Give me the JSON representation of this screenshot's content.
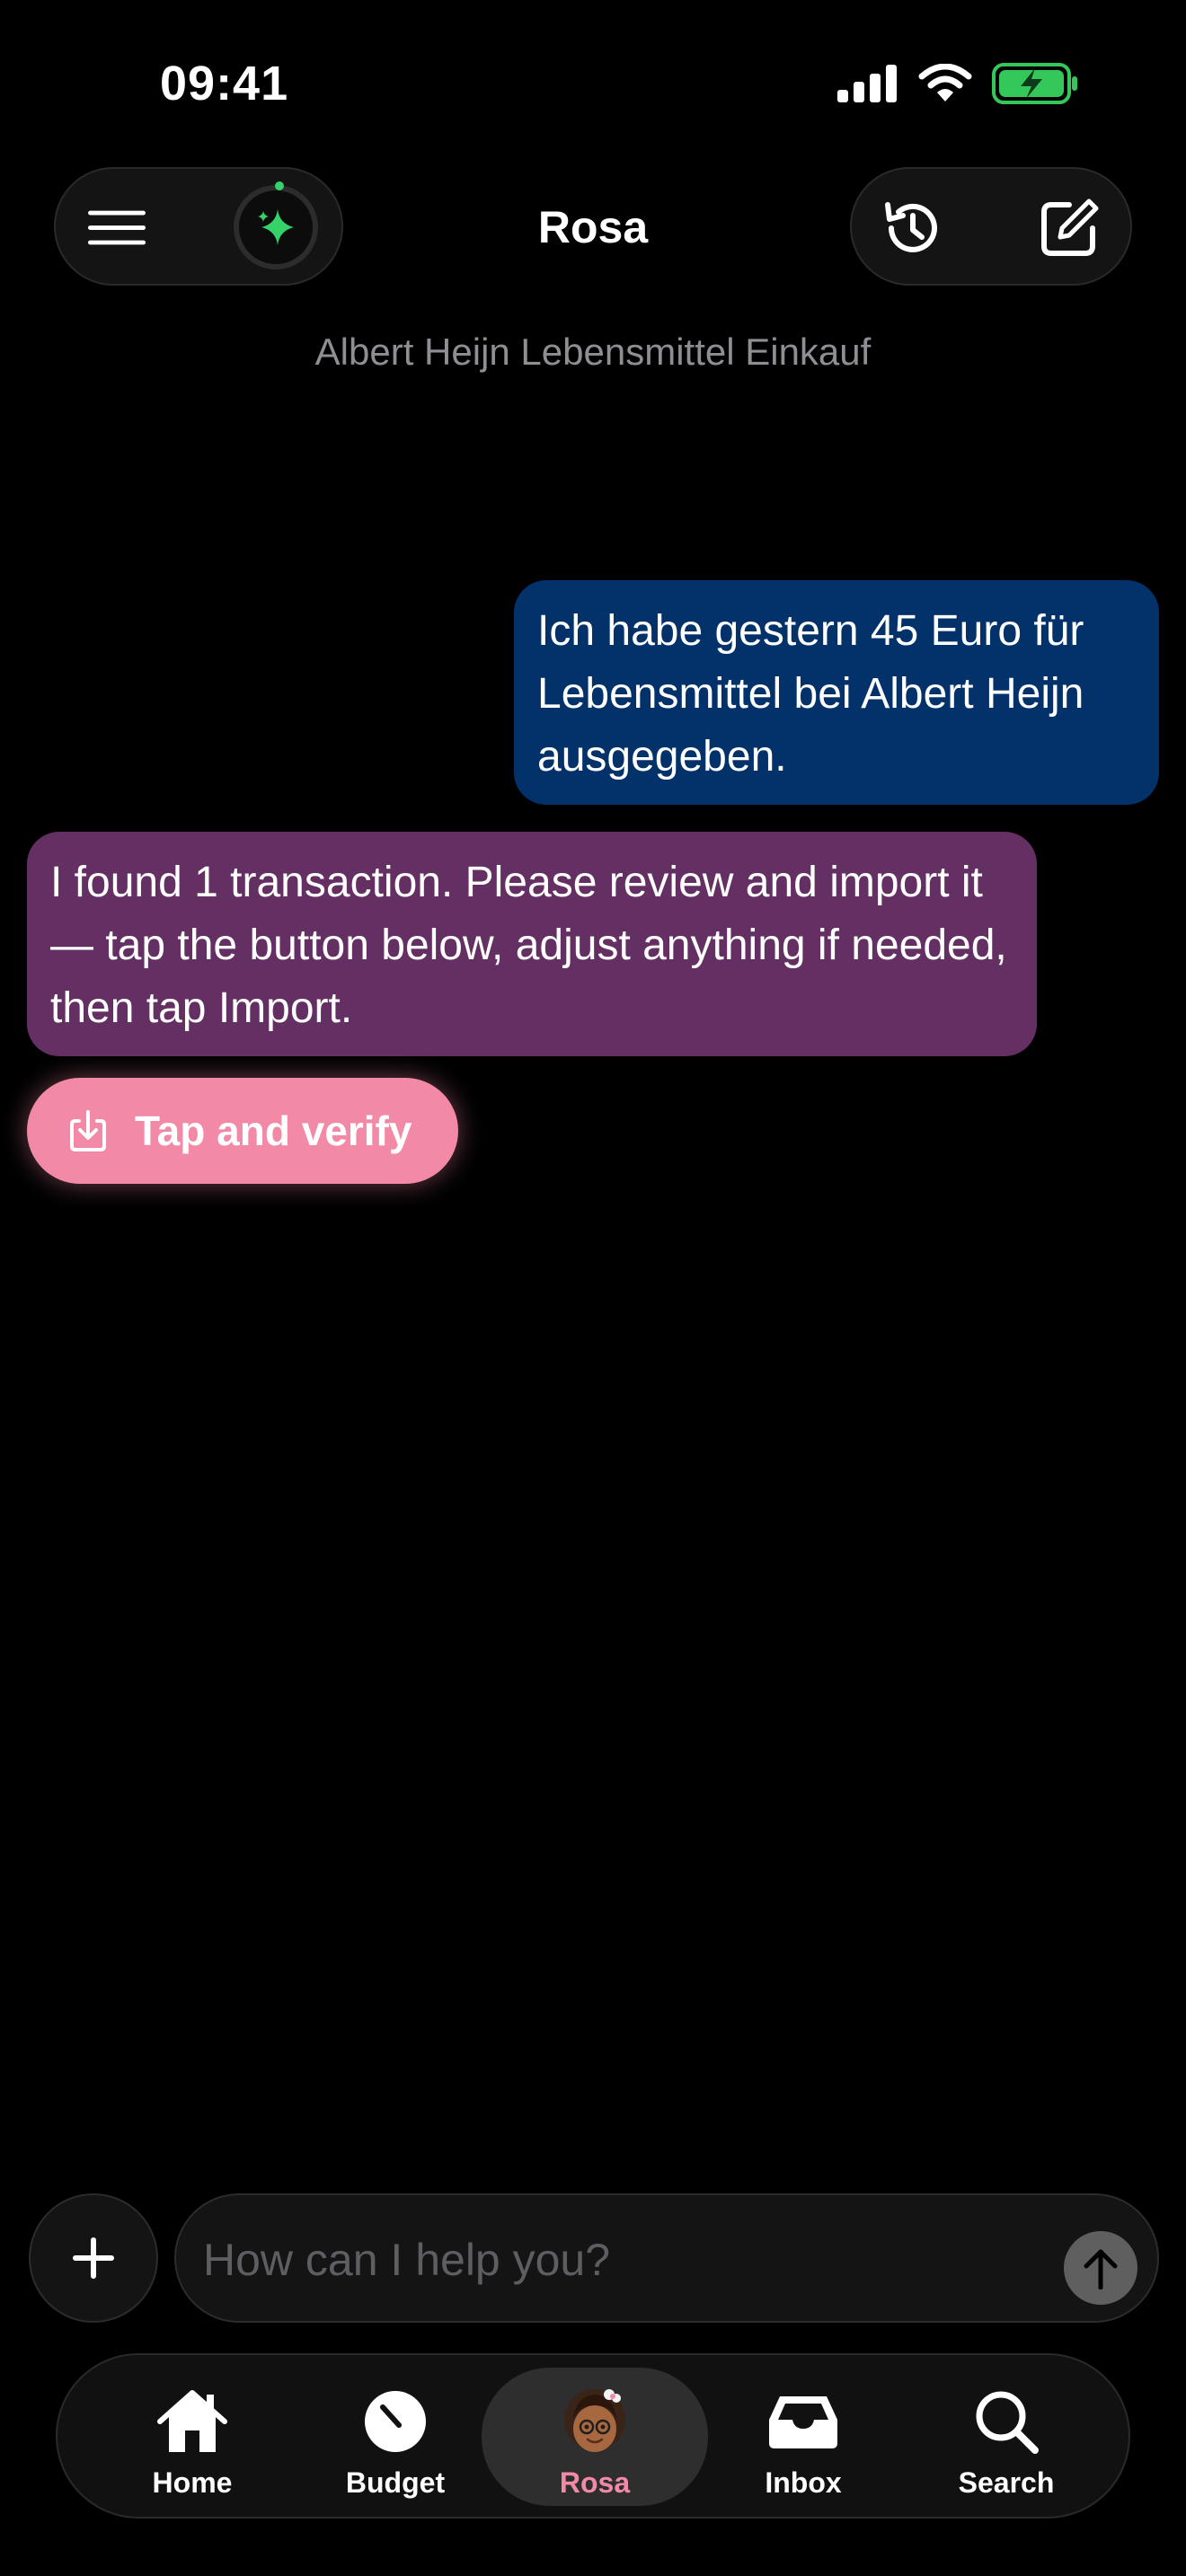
{
  "status_bar": {
    "time": "09:41",
    "icons": [
      "cellular-signal-icon",
      "wifi-icon",
      "battery-charging-icon"
    ],
    "battery_color": "#34c759"
  },
  "header": {
    "title": "Rosa",
    "subtitle": "Albert Heijn Lebensmittel Einkauf",
    "left_icons": [
      "menu-icon",
      "sparkle-icon"
    ],
    "right_icons": [
      "history-icon",
      "compose-icon"
    ],
    "sparkle_color": "#35d26a"
  },
  "messages": [
    {
      "role": "user",
      "text": "Ich habe gestern 45 Euro für Lebensmittel bei Albert Heijn ausgegeben.",
      "color": "#03316a"
    },
    {
      "role": "assistant",
      "text": "I found 1 transaction. Please review and import it — tap the button below, adjust anything if needed, then tap Import.",
      "color": "#642f63"
    }
  ],
  "action_button": {
    "label": "Tap and verify",
    "icon": "download-tray-icon",
    "color": "#f28aa7"
  },
  "composer": {
    "placeholder": "How can I help you?",
    "value": "",
    "add_icon": "plus-icon",
    "send_icon": "arrow-up-icon"
  },
  "tabbar": {
    "accent": "#f28aa7",
    "tabs": [
      {
        "label": "Home",
        "icon": "house-icon"
      },
      {
        "label": "Budget",
        "icon": "gauge-icon"
      },
      {
        "label": "Rosa",
        "icon": "avatar-icon",
        "active": true
      },
      {
        "label": "Inbox",
        "icon": "inbox-tray-icon"
      },
      {
        "label": "Search",
        "icon": "magnifier-icon"
      }
    ]
  }
}
